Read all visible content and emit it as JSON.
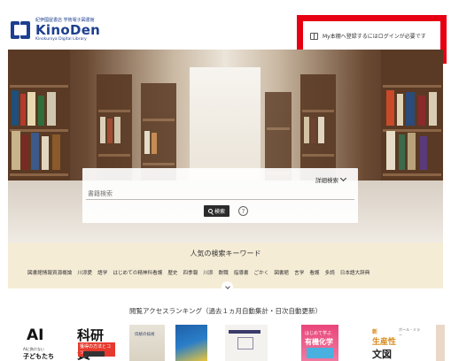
{
  "header": {
    "logo_sub": "紀伊國屋書店 学術電子図書館",
    "logo_main": "KinoDen",
    "logo_eng": "Kinokuniya Digital Library",
    "login_notice": "My本棚へ登録するにはログインが必要です"
  },
  "search": {
    "placeholder": "書籍検索",
    "advanced_label": "詳細検索",
    "button_label": "検索",
    "help_glyph": "?"
  },
  "keywords": {
    "title": "人気の検索キーワード",
    "items": [
      "図書館情報資源概論",
      "川添愛",
      "語学",
      "はじめての精神科看護",
      "歴史",
      "四季報",
      "川添",
      "数職",
      "指導書",
      "ごかく",
      "図書館",
      "言学",
      "看護",
      "多読",
      "日本語大辞典"
    ]
  },
  "ranking": {
    "title": "閲覧アクセスランキング（過去１ヵ月自動集計・日次自動更新）",
    "books": [
      {
        "big": "AI",
        "small": "AIに負けない",
        "small2": "子どもたち"
      },
      {
        "big": "科研費",
        "tag": "獲得の方法とコツ"
      },
      {
        "title": "伝統の技術"
      },
      {},
      {},
      {
        "txt1": "はじめて学ぶ",
        "txt2": "有機化学"
      },
      {
        "t1": "新",
        "t2": "生産性",
        "t3": "文図",
        "t4": "ポール・ミラー"
      },
      {}
    ]
  },
  "colors": {
    "brand": "#1d3f8f",
    "highlight_border": "#e60012",
    "keyword_band": "#f5ecd6",
    "search_button": "#2b2b2b"
  }
}
